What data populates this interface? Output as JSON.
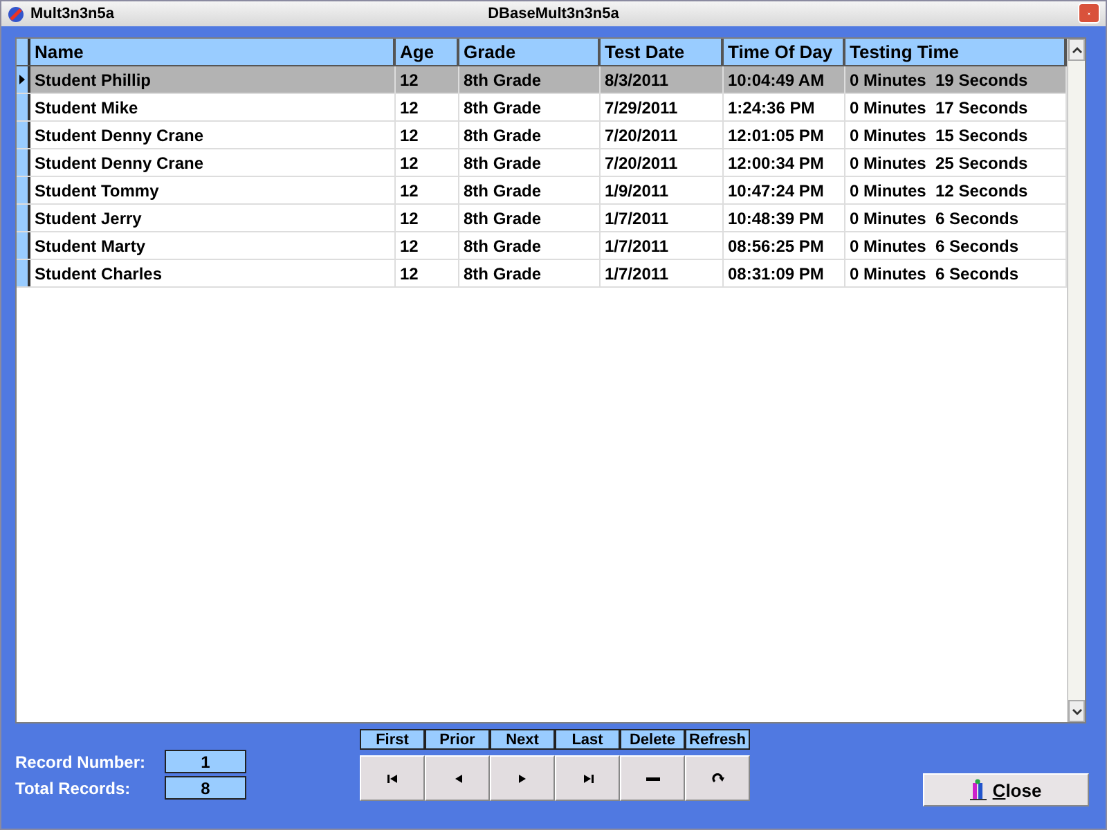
{
  "window": {
    "app_title": "Mult3n3n5a",
    "title": "DBaseMult3n3n5a"
  },
  "table": {
    "columns": [
      "Name",
      "Age",
      "Grade",
      "Test Date",
      "Time Of Day",
      "Testing Time"
    ],
    "rows": [
      {
        "selected": true,
        "cells": [
          "Student Phillip",
          "12",
          "8th Grade",
          "8/3/2011",
          "10:04:49 AM",
          "0 Minutes  19 Seconds"
        ]
      },
      {
        "selected": false,
        "cells": [
          "Student Mike",
          "12",
          "8th Grade",
          "7/29/2011",
          "1:24:36 PM",
          "0 Minutes  17 Seconds"
        ]
      },
      {
        "selected": false,
        "cells": [
          "Student Denny Crane",
          "12",
          "8th Grade",
          "7/20/2011",
          "12:01:05 PM",
          "0 Minutes  15 Seconds"
        ]
      },
      {
        "selected": false,
        "cells": [
          "Student Denny Crane",
          "12",
          "8th Grade",
          "7/20/2011",
          "12:00:34 PM",
          "0 Minutes  25 Seconds"
        ]
      },
      {
        "selected": false,
        "cells": [
          "Student Tommy",
          "12",
          "8th Grade",
          "1/9/2011",
          "10:47:24 PM",
          "0 Minutes  12 Seconds"
        ]
      },
      {
        "selected": false,
        "cells": [
          "Student Jerry",
          "12",
          "8th Grade",
          "1/7/2011",
          "10:48:39 PM",
          "0 Minutes  6 Seconds"
        ]
      },
      {
        "selected": false,
        "cells": [
          "Student Marty",
          "12",
          "8th Grade",
          "1/7/2011",
          "08:56:25 PM",
          "0 Minutes  6 Seconds"
        ]
      },
      {
        "selected": false,
        "cells": [
          "Student Charles",
          "12",
          "8th Grade",
          "1/7/2011",
          "08:31:09 PM",
          "0 Minutes  6 Seconds"
        ]
      }
    ]
  },
  "record_info": [
    {
      "label": "Record Number:",
      "value": "1"
    },
    {
      "label": "Total Records:",
      "value": "8"
    }
  ],
  "navigator": [
    {
      "label": "First",
      "kind": "first"
    },
    {
      "label": "Prior",
      "kind": "prior"
    },
    {
      "label": "Next",
      "kind": "next"
    },
    {
      "label": "Last",
      "kind": "last"
    },
    {
      "label": "Delete",
      "kind": "delete"
    },
    {
      "label": "Refresh",
      "kind": "refresh"
    }
  ],
  "close_button": "Close"
}
